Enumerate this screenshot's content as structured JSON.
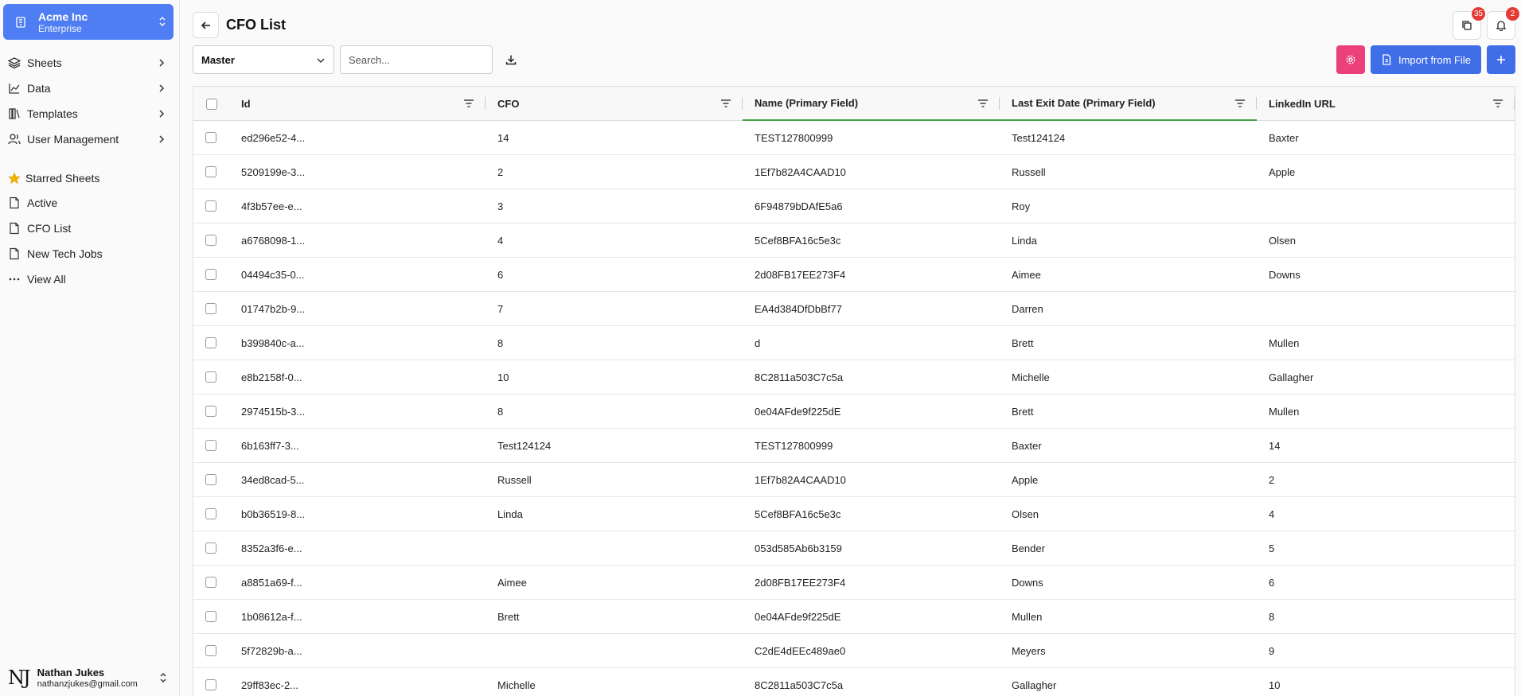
{
  "org": {
    "name": "Acme Inc",
    "plan": "Enterprise"
  },
  "nav": [
    {
      "label": "Sheets",
      "icon": "layers-icon"
    },
    {
      "label": "Data",
      "icon": "chart-icon"
    },
    {
      "label": "Templates",
      "icon": "book-icon"
    },
    {
      "label": "User Management",
      "icon": "users-icon"
    }
  ],
  "starred": {
    "label": "Starred Sheets",
    "items": [
      {
        "label": "Active",
        "icon": "file-icon"
      },
      {
        "label": "CFO List",
        "icon": "file-icon"
      },
      {
        "label": "New Tech Jobs",
        "icon": "file-icon"
      },
      {
        "label": "View All",
        "icon": "more-icon"
      }
    ]
  },
  "user": {
    "initials": "NJ",
    "name": "Nathan Jukes",
    "email": "nathanzjukes@gmail.com"
  },
  "header": {
    "title": "CFO List",
    "copies_badge": "35",
    "notifications_badge": "2"
  },
  "toolbar": {
    "view": "Master",
    "search_placeholder": "Search...",
    "import_label": "Import from File"
  },
  "colors": {
    "accent": "#3f6ee8",
    "org": "#4f7df3",
    "pink": "#ec407a",
    "primary_underline": "#43a047",
    "badge": "#e53935"
  },
  "columns": [
    "Id",
    "CFO",
    "Name (Primary Field)",
    "Last Exit Date (Primary Field)",
    "LinkedIn URL"
  ],
  "rows": [
    [
      "ed296e52-4...",
      "14",
      "TEST127800999",
      "Test124124",
      "Baxter"
    ],
    [
      "5209199e-3...",
      "2",
      "1Ef7b82A4CAAD10",
      "Russell",
      "Apple"
    ],
    [
      "4f3b57ee-e...",
      "3",
      "6F94879bDAfE5a6",
      "Roy",
      ""
    ],
    [
      "a6768098-1...",
      "4",
      "5Cef8BFA16c5e3c",
      "Linda",
      "Olsen"
    ],
    [
      "04494c35-0...",
      "6",
      "2d08FB17EE273F4",
      "Aimee",
      "Downs"
    ],
    [
      "01747b2b-9...",
      "7",
      "EA4d384DfDbBf77",
      "Darren",
      ""
    ],
    [
      "b399840c-a...",
      "8",
      "d",
      "Brett",
      "Mullen"
    ],
    [
      "e8b2158f-0...",
      "10",
      "8C2811a503C7c5a",
      "Michelle",
      "Gallagher"
    ],
    [
      "2974515b-3...",
      "8",
      "0e04AFde9f225dE",
      "Brett",
      "Mullen"
    ],
    [
      "6b163ff7-3...",
      "Test124124",
      "TEST127800999",
      "Baxter",
      "14"
    ],
    [
      "34ed8cad-5...",
      "Russell",
      "1Ef7b82A4CAAD10",
      "Apple",
      "2"
    ],
    [
      "b0b36519-8...",
      "Linda",
      "5Cef8BFA16c5e3c",
      "Olsen",
      "4"
    ],
    [
      "8352a3f6-e...",
      "",
      "053d585Ab6b3159",
      "Bender",
      "5"
    ],
    [
      "a8851a69-f...",
      "Aimee",
      "2d08FB17EE273F4",
      "Downs",
      "6"
    ],
    [
      "1b08612a-f...",
      "Brett",
      "0e04AFde9f225dE",
      "Mullen",
      "8"
    ],
    [
      "5f72829b-a...",
      "",
      "C2dE4dEEc489ae0",
      "Meyers",
      "9"
    ],
    [
      "29ff83ec-2...",
      "Michelle",
      "8C2811a503C7c5a",
      "Gallagher",
      "10"
    ]
  ]
}
